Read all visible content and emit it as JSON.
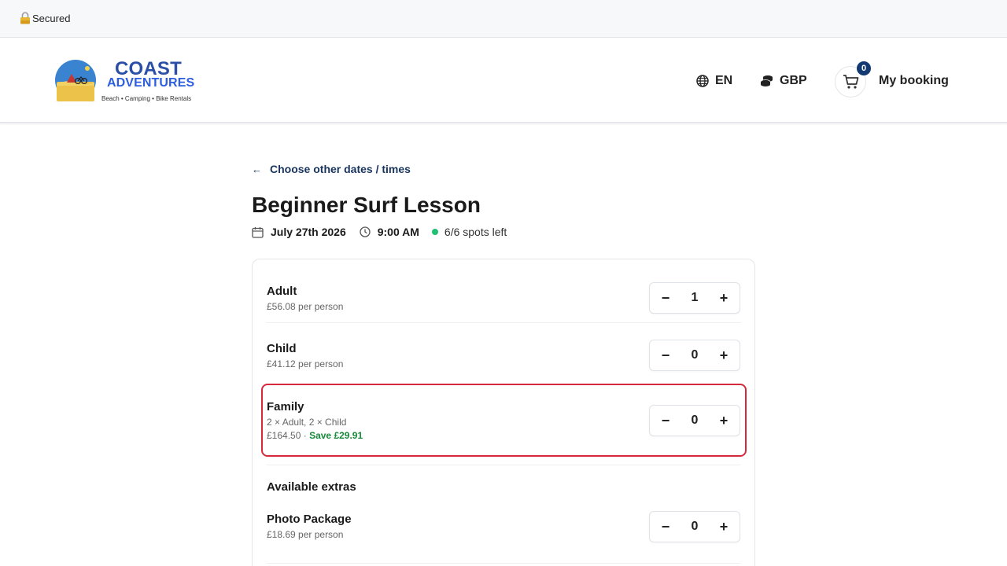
{
  "secure_bar": {
    "label": "Secured",
    "icon": "lock-icon"
  },
  "brand": {
    "line1": "COAST",
    "line2": "ADVENTURES",
    "tagline": "Beach • Camping • Bike Rentals"
  },
  "header": {
    "language": "EN",
    "currency": "GBP",
    "cart_count": "0",
    "booking_label": "My booking"
  },
  "activity": {
    "back_label": "Choose other dates / times",
    "title": "Beginner Surf Lesson",
    "date": "July 27th 2026",
    "time": "9:00 AM",
    "spots": "6/6 spots left"
  },
  "tickets": [
    {
      "name": "Adult",
      "price": "£56.08 per person",
      "qty": "1"
    },
    {
      "name": "Child",
      "price": "£41.12 per person",
      "qty": "0"
    },
    {
      "name": "Family",
      "details": "2 × Adult, 2 × Child",
      "price": "£164.50",
      "separator": "·",
      "save": "Save £29.91",
      "qty": "0"
    }
  ],
  "extras": {
    "title": "Available extras",
    "items": [
      {
        "name": "Photo Package",
        "price": "£18.69 per person",
        "qty": "0"
      }
    ]
  },
  "stepper": {
    "minus": "−",
    "plus": "+"
  },
  "colors": {
    "brand_dark": "#2b4fa7",
    "brand_blue": "#2d5ee0",
    "link": "#18345e",
    "badge": "#123a70",
    "available_dot": "#1fbf74",
    "save_green": "#178a3a",
    "highlight_border": "#d62a3c"
  }
}
